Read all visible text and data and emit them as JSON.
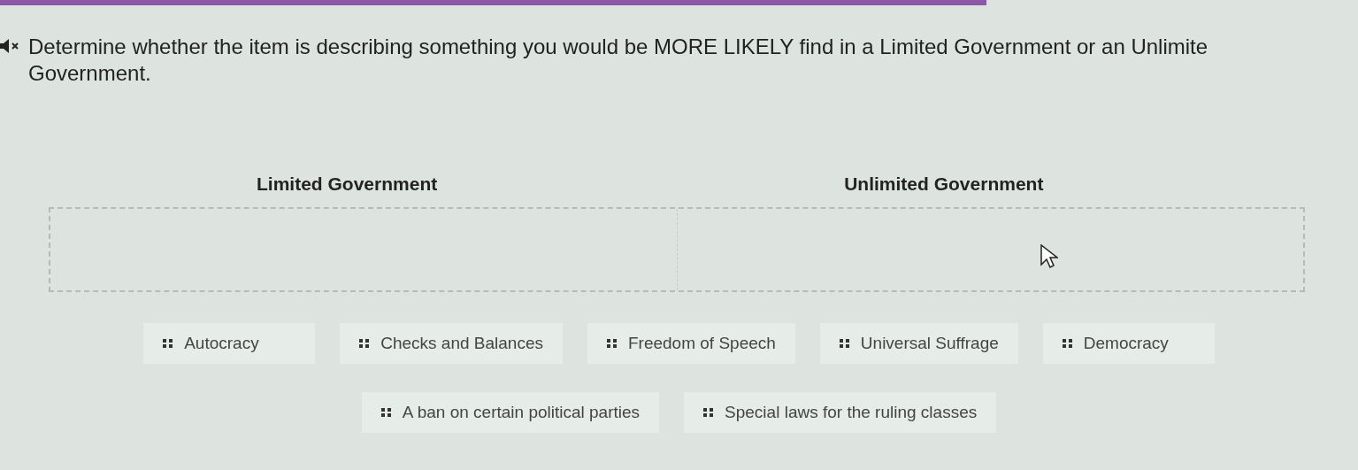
{
  "prompt": "Determine whether the item is describing something you would be MORE LIKELY find in a Limited Government or an Unlimite",
  "prompt_cont": "Government.",
  "zones": [
    {
      "title": "Limited Government"
    },
    {
      "title": "Unlimited Government"
    }
  ],
  "item_rows": [
    [
      "Autocracy",
      "Checks and Balances",
      "Freedom of Speech",
      "Universal Suffrage",
      "Democracy"
    ],
    [
      "A ban on certain political parties",
      "Special laws for the ruling classes"
    ]
  ]
}
